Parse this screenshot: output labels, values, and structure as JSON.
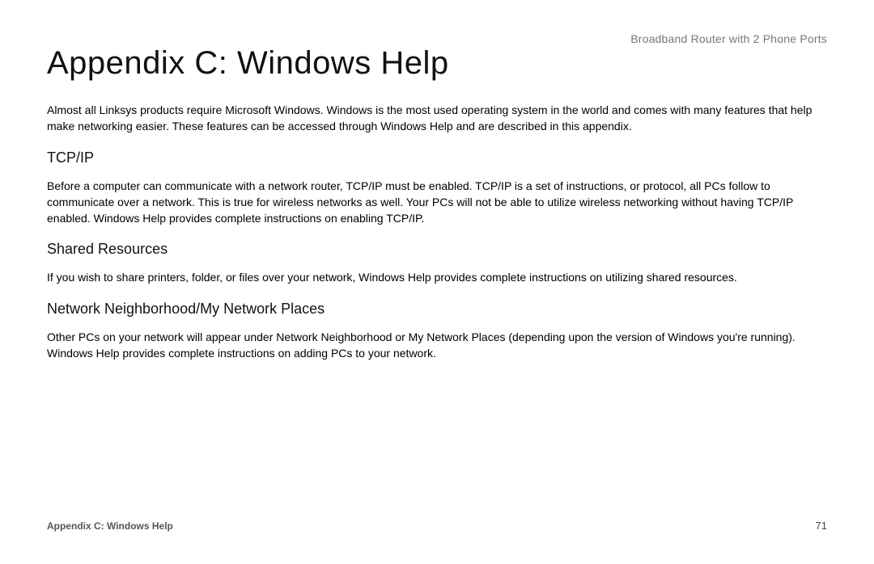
{
  "header": {
    "product_name": "Broadband Router with 2 Phone Ports"
  },
  "title": "Appendix C: Windows Help",
  "paragraphs": {
    "intro": "Almost all Linksys products require Microsoft Windows. Windows is the most used operating system in the world and comes with many features that help make networking easier. These features can be accessed through Windows Help and are described in this appendix.",
    "tcpip_heading": "TCP/IP",
    "tcpip_body": "Before a computer can communicate with a network router, TCP/IP must be enabled. TCP/IP is a set of instructions, or protocol, all PCs follow to communicate over a network. This is true for wireless networks as well. Your PCs will not be able to utilize wireless networking without having TCP/IP enabled. Windows Help provides complete instructions on enabling TCP/IP.",
    "shared_heading": "Shared Resources",
    "shared_body": "If you wish to share printers, folder, or files over your network, Windows Help provides complete instructions on utilizing shared resources.",
    "network_heading": "Network Neighborhood/My Network Places",
    "network_body": "Other PCs on your network will appear under Network Neighborhood or My Network Places (depending upon the version of Windows you're running). Windows Help provides complete instructions on adding PCs to your network."
  },
  "footer": {
    "section_label": "Appendix C: Windows Help",
    "page_number": "71"
  }
}
